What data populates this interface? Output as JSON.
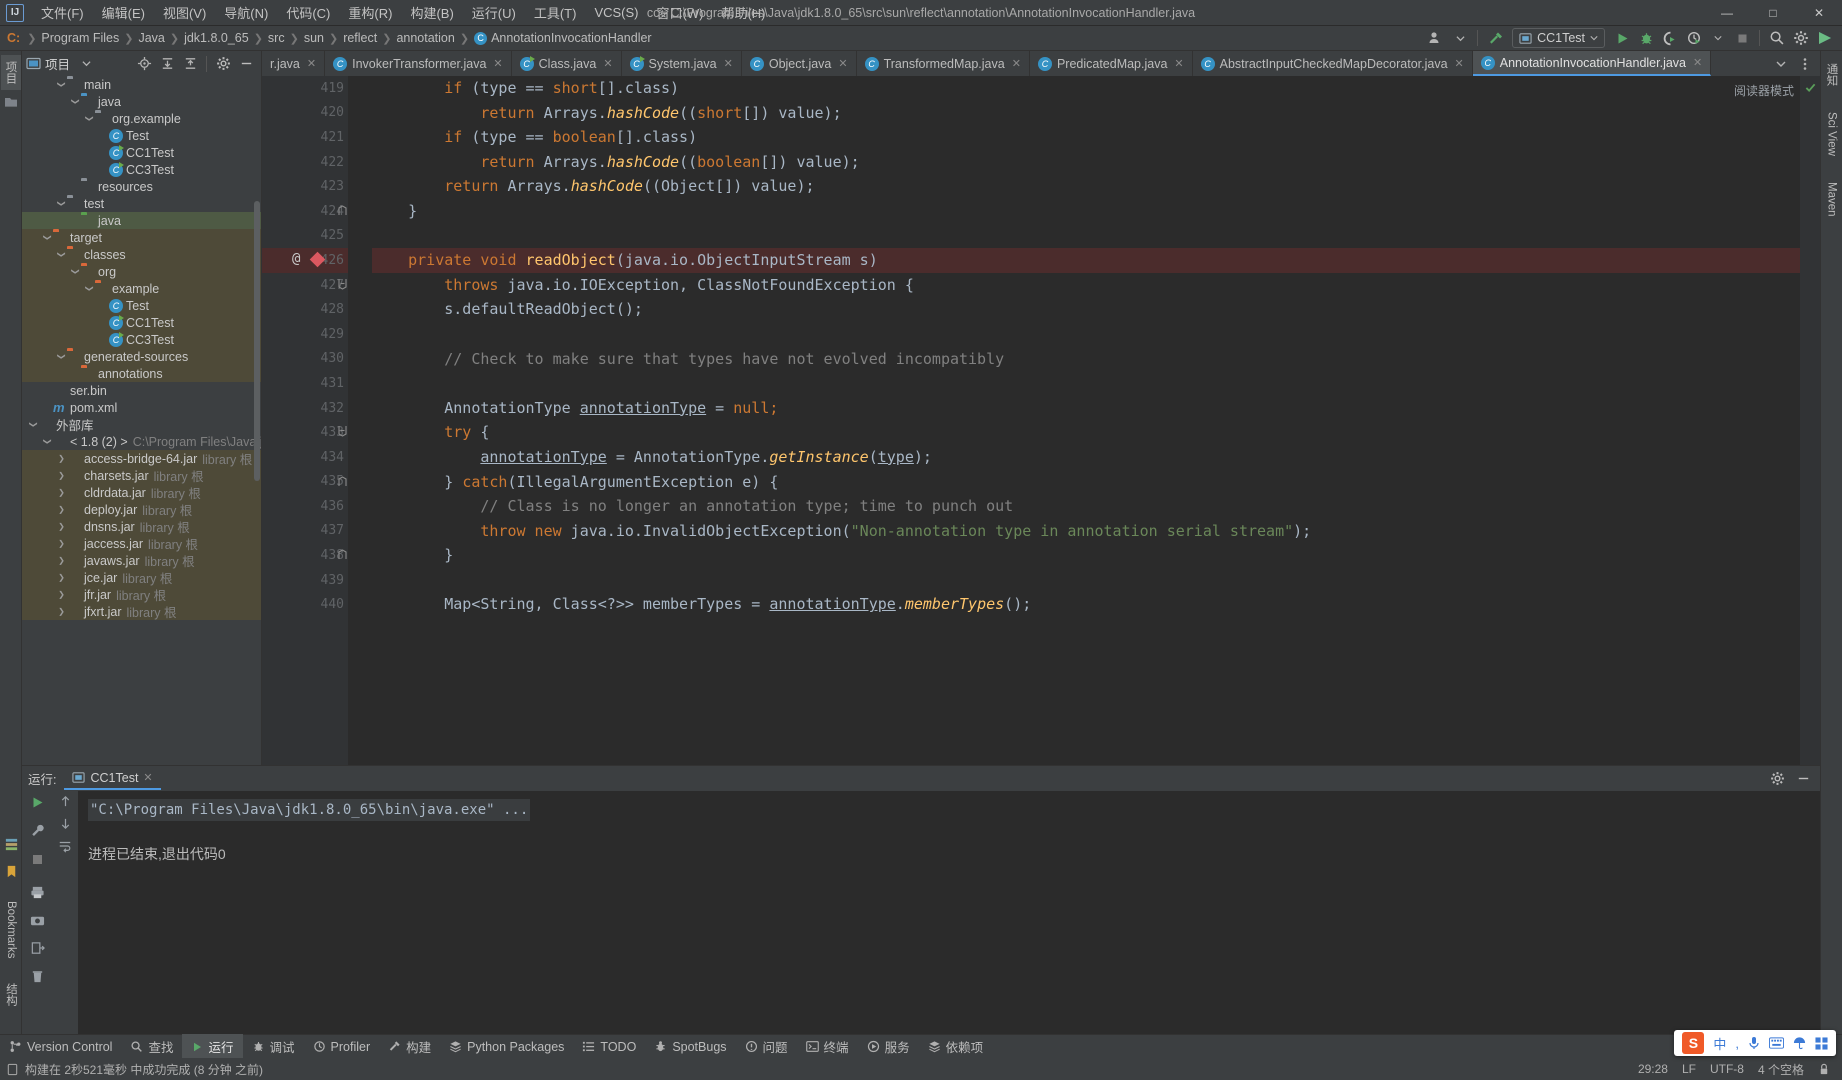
{
  "window": {
    "title": "cc - C:\\Program Files\\Java\\jdk1.8.0_65\\src\\sun\\reflect\\annotation\\AnnotationInvocationHandler.java",
    "logo": "IJ",
    "minimize": "—",
    "maximize": "□",
    "close": "✕"
  },
  "menubar": [
    {
      "label": "文件(F)"
    },
    {
      "label": "编辑(E)"
    },
    {
      "label": "视图(V)"
    },
    {
      "label": "导航(N)"
    },
    {
      "label": "代码(C)"
    },
    {
      "label": "重构(R)"
    },
    {
      "label": "构建(B)"
    },
    {
      "label": "运行(U)"
    },
    {
      "label": "工具(T)"
    },
    {
      "label": "VCS(S)"
    },
    {
      "label": "窗口(W)"
    },
    {
      "label": "帮助(H)"
    }
  ],
  "breadcrumbs": [
    {
      "label": "C:",
      "icon": "drive"
    },
    {
      "label": "Program Files",
      "icon": "folder"
    },
    {
      "label": "Java",
      "icon": "folder"
    },
    {
      "label": "jdk1.8.0_65",
      "icon": "folder"
    },
    {
      "label": "src",
      "icon": "folder"
    },
    {
      "label": "sun",
      "icon": "folder"
    },
    {
      "label": "reflect",
      "icon": "folder"
    },
    {
      "label": "annotation",
      "icon": "folder"
    },
    {
      "label": "AnnotationInvocationHandler",
      "icon": "class"
    }
  ],
  "toolbar": {
    "run_config": "CC1Test",
    "buttons": [
      {
        "name": "user-icon",
        "title": "用户"
      },
      {
        "name": "build-hammer-icon",
        "title": "构建"
      },
      {
        "name": "run-icon",
        "title": "运行"
      },
      {
        "name": "debug-icon",
        "title": "调试"
      },
      {
        "name": "run-with-coverage-icon",
        "title": "运行并计算覆盖率"
      },
      {
        "name": "profiler-icon",
        "title": "Profiler"
      },
      {
        "name": "stop-icon",
        "title": "停止"
      },
      {
        "name": "search-icon",
        "title": "搜索"
      },
      {
        "name": "settings-gear-icon",
        "title": "设置"
      },
      {
        "name": "app-badge-icon",
        "title": "IDE"
      }
    ]
  },
  "project_panel": {
    "title": "项目",
    "header_buttons": [
      "locate-icon",
      "expand-all-icon",
      "collapse-all-icon",
      "settings-gear-icon",
      "hide-icon"
    ],
    "tree": [
      {
        "label": "main",
        "indent": 2,
        "arrow": "v",
        "icon": "folder-grey",
        "state": "normal"
      },
      {
        "label": "java",
        "indent": 3,
        "arrow": "v",
        "icon": "folder-blue",
        "state": "normal"
      },
      {
        "label": "org.example",
        "indent": 4,
        "arrow": "v",
        "icon": "folder-pkg",
        "state": "normal"
      },
      {
        "label": "Test",
        "indent": 5,
        "arrow": "",
        "icon": "class",
        "state": "normal"
      },
      {
        "label": "CC1Test",
        "indent": 5,
        "arrow": "",
        "icon": "class-run",
        "state": "normal"
      },
      {
        "label": "CC3Test",
        "indent": 5,
        "arrow": "",
        "icon": "class-run",
        "state": "normal"
      },
      {
        "label": "resources",
        "indent": 3,
        "arrow": "",
        "icon": "folder-res",
        "state": "normal"
      },
      {
        "label": "test",
        "indent": 2,
        "arrow": "v",
        "icon": "folder-grey",
        "state": "normal"
      },
      {
        "label": "java",
        "indent": 3,
        "arrow": "",
        "icon": "folder-green",
        "state": "selected-green"
      },
      {
        "label": "target",
        "indent": 1,
        "arrow": "v",
        "icon": "folder-orange",
        "state": "context"
      },
      {
        "label": "classes",
        "indent": 2,
        "arrow": "v",
        "icon": "folder-orange",
        "state": "context"
      },
      {
        "label": "org",
        "indent": 3,
        "arrow": "v",
        "icon": "folder-orange",
        "state": "context"
      },
      {
        "label": "example",
        "indent": 4,
        "arrow": "v",
        "icon": "folder-orange",
        "state": "context"
      },
      {
        "label": "Test",
        "indent": 5,
        "arrow": "",
        "icon": "class",
        "state": "context"
      },
      {
        "label": "CC1Test",
        "indent": 5,
        "arrow": "",
        "icon": "class-run",
        "state": "context"
      },
      {
        "label": "CC3Test",
        "indent": 5,
        "arrow": "",
        "icon": "class-run",
        "state": "context"
      },
      {
        "label": "generated-sources",
        "indent": 2,
        "arrow": "v",
        "icon": "folder-orange",
        "state": "context"
      },
      {
        "label": "annotations",
        "indent": 3,
        "arrow": "",
        "icon": "folder-orange",
        "state": "context"
      },
      {
        "label": "ser.bin",
        "indent": 1,
        "arrow": "",
        "icon": "bin",
        "state": "normal"
      },
      {
        "label": "pom.xml",
        "indent": 1,
        "arrow": "",
        "icon": "maven",
        "state": "normal"
      },
      {
        "label": "外部库",
        "indent": 0,
        "arrow": "v",
        "icon": "library",
        "state": "normal"
      },
      {
        "label": "< 1.8 (2) >",
        "indent": 1,
        "arrow": "v",
        "icon": "sdk",
        "state": "normal",
        "sub": "C:\\Program Files\\Java\\jdk"
      },
      {
        "label": "access-bridge-64.jar",
        "indent": 2,
        "arrow": ">",
        "icon": "jar",
        "state": "context",
        "sub": "library 根"
      },
      {
        "label": "charsets.jar",
        "indent": 2,
        "arrow": ">",
        "icon": "jar",
        "state": "context",
        "sub": "library 根"
      },
      {
        "label": "cldrdata.jar",
        "indent": 2,
        "arrow": ">",
        "icon": "jar",
        "state": "context",
        "sub": "library 根"
      },
      {
        "label": "deploy.jar",
        "indent": 2,
        "arrow": ">",
        "icon": "jar",
        "state": "context",
        "sub": "library 根"
      },
      {
        "label": "dnsns.jar",
        "indent": 2,
        "arrow": ">",
        "icon": "jar",
        "state": "context",
        "sub": "library 根"
      },
      {
        "label": "jaccess.jar",
        "indent": 2,
        "arrow": ">",
        "icon": "jar",
        "state": "context",
        "sub": "library 根"
      },
      {
        "label": "javaws.jar",
        "indent": 2,
        "arrow": ">",
        "icon": "jar",
        "state": "context",
        "sub": "library 根"
      },
      {
        "label": "jce.jar",
        "indent": 2,
        "arrow": ">",
        "icon": "jar",
        "state": "context",
        "sub": "library 根"
      },
      {
        "label": "jfr.jar",
        "indent": 2,
        "arrow": ">",
        "icon": "jar",
        "state": "context",
        "sub": "library 根"
      },
      {
        "label": "jfxrt.jar",
        "indent": 2,
        "arrow": ">",
        "icon": "jar",
        "state": "context",
        "sub": "library 根"
      }
    ]
  },
  "left_strip": {
    "tabs": [
      "项目",
      "收藏"
    ],
    "bottom_tabs": [
      "Bookmarks",
      "结构"
    ]
  },
  "right_strip": {
    "tabs": [
      "通知",
      "Sci View",
      "Maven"
    ]
  },
  "editor": {
    "tabs": [
      {
        "label": "r.java",
        "icon": "class",
        "active": false,
        "clipped": true
      },
      {
        "label": "InvokerTransformer.java",
        "icon": "class",
        "active": false
      },
      {
        "label": "Class.java",
        "icon": "class-run",
        "active": false
      },
      {
        "label": "System.java",
        "icon": "class-run",
        "active": false
      },
      {
        "label": "Object.java",
        "icon": "class",
        "active": false
      },
      {
        "label": "TransformedMap.java",
        "icon": "class",
        "active": false
      },
      {
        "label": "PredicatedMap.java",
        "icon": "class",
        "active": false
      },
      {
        "label": "AbstractInputCheckedMapDecorator.java",
        "icon": "class-abstract",
        "active": false
      },
      {
        "label": "AnnotationInvocationHandler.java",
        "icon": "class",
        "active": true
      }
    ],
    "reader_mode": "阅读器模式",
    "first_line": 419,
    "lines": [
      {
        "n": 419,
        "fold": "",
        "marker": "",
        "highlight": false,
        "tokens": [
          {
            "t": "        ",
            "c": ""
          },
          {
            "t": "if",
            "c": "kw"
          },
          {
            "t": " (type == ",
            "c": "typ"
          },
          {
            "t": "short",
            "c": "kw"
          },
          {
            "t": "[].class)",
            "c": "typ"
          }
        ]
      },
      {
        "n": 420,
        "fold": "",
        "marker": "",
        "highlight": false,
        "tokens": [
          {
            "t": "            ",
            "c": ""
          },
          {
            "t": "return",
            "c": "kw"
          },
          {
            "t": " Arrays.",
            "c": "typ"
          },
          {
            "t": "hashCode",
            "c": "fni"
          },
          {
            "t": "((",
            "c": "typ"
          },
          {
            "t": "short",
            "c": "kw"
          },
          {
            "t": "[]) value);",
            "c": "typ"
          }
        ]
      },
      {
        "n": 421,
        "fold": "",
        "marker": "",
        "highlight": false,
        "tokens": [
          {
            "t": "        ",
            "c": ""
          },
          {
            "t": "if",
            "c": "kw"
          },
          {
            "t": " (type == ",
            "c": "typ"
          },
          {
            "t": "boolean",
            "c": "kw"
          },
          {
            "t": "[].class)",
            "c": "typ"
          }
        ]
      },
      {
        "n": 422,
        "fold": "",
        "marker": "",
        "highlight": false,
        "tokens": [
          {
            "t": "            ",
            "c": ""
          },
          {
            "t": "return",
            "c": "kw"
          },
          {
            "t": " Arrays.",
            "c": "typ"
          },
          {
            "t": "hashCode",
            "c": "fni"
          },
          {
            "t": "((",
            "c": "typ"
          },
          {
            "t": "boolean",
            "c": "kw"
          },
          {
            "t": "[]) value);",
            "c": "typ"
          }
        ]
      },
      {
        "n": 423,
        "fold": "",
        "marker": "",
        "highlight": false,
        "tokens": [
          {
            "t": "        ",
            "c": ""
          },
          {
            "t": "return",
            "c": "kw"
          },
          {
            "t": " Arrays.",
            "c": "typ"
          },
          {
            "t": "hashCode",
            "c": "fni"
          },
          {
            "t": "((Object[]) value);",
            "c": "typ"
          }
        ]
      },
      {
        "n": 424,
        "fold": "end",
        "marker": "",
        "highlight": false,
        "tokens": [
          {
            "t": "    }",
            "c": "typ"
          }
        ]
      },
      {
        "n": 425,
        "fold": "",
        "marker": "",
        "highlight": false,
        "tokens": []
      },
      {
        "n": 426,
        "fold": "",
        "marker": "breakpoint",
        "highlight": true,
        "tokens": [
          {
            "t": "    ",
            "c": ""
          },
          {
            "t": "private void ",
            "c": "kw"
          },
          {
            "t": "readObject",
            "c": "fn"
          },
          {
            "t": "(java.io.ObjectInputStream s)",
            "c": "typ"
          }
        ]
      },
      {
        "n": 427,
        "fold": "start",
        "marker": "",
        "highlight": false,
        "tokens": [
          {
            "t": "        ",
            "c": ""
          },
          {
            "t": "throws",
            "c": "kw"
          },
          {
            "t": " java.io.IOException, ClassNotFoundException {",
            "c": "typ"
          }
        ]
      },
      {
        "n": 428,
        "fold": "",
        "marker": "",
        "highlight": false,
        "tokens": [
          {
            "t": "        s.defaultReadObject();",
            "c": "typ"
          }
        ]
      },
      {
        "n": 429,
        "fold": "",
        "marker": "",
        "highlight": false,
        "tokens": []
      },
      {
        "n": 430,
        "fold": "",
        "marker": "",
        "highlight": false,
        "tokens": [
          {
            "t": "        // Check to make sure that types have not evolved incompatibly",
            "c": "cmt"
          }
        ]
      },
      {
        "n": 431,
        "fold": "",
        "marker": "",
        "highlight": false,
        "tokens": []
      },
      {
        "n": 432,
        "fold": "",
        "marker": "",
        "highlight": false,
        "tokens": [
          {
            "t": "        AnnotationType ",
            "c": "typ"
          },
          {
            "t": "annotationType",
            "c": "loc"
          },
          {
            "t": " = ",
            "c": "typ"
          },
          {
            "t": "null;",
            "c": "kw"
          }
        ]
      },
      {
        "n": 433,
        "fold": "start",
        "marker": "",
        "highlight": false,
        "tokens": [
          {
            "t": "        ",
            "c": ""
          },
          {
            "t": "try",
            "c": "kw"
          },
          {
            "t": " {",
            "c": "typ"
          }
        ]
      },
      {
        "n": 434,
        "fold": "",
        "marker": "",
        "highlight": false,
        "tokens": [
          {
            "t": "            ",
            "c": ""
          },
          {
            "t": "annotationType",
            "c": "loc"
          },
          {
            "t": " = AnnotationType.",
            "c": "typ"
          },
          {
            "t": "getInstance",
            "c": "fni"
          },
          {
            "t": "(",
            "c": "typ"
          },
          {
            "t": "type",
            "c": "loc"
          },
          {
            "t": ");",
            "c": "typ"
          }
        ]
      },
      {
        "n": 435,
        "fold": "end",
        "marker": "",
        "highlight": false,
        "tokens": [
          {
            "t": "        } ",
            "c": "typ"
          },
          {
            "t": "catch",
            "c": "kw"
          },
          {
            "t": "(IllegalArgumentException e) {",
            "c": "typ"
          }
        ]
      },
      {
        "n": 436,
        "fold": "",
        "marker": "",
        "highlight": false,
        "tokens": [
          {
            "t": "            // Class is no longer an annotation type; time to punch out",
            "c": "cmt"
          }
        ]
      },
      {
        "n": 437,
        "fold": "",
        "marker": "",
        "highlight": false,
        "tokens": [
          {
            "t": "            ",
            "c": ""
          },
          {
            "t": "throw new",
            "c": "kw"
          },
          {
            "t": " java.io.InvalidObjectException(",
            "c": "typ"
          },
          {
            "t": "\"Non-annotation type in annotation serial stream\"",
            "c": "str"
          },
          {
            "t": ");",
            "c": "typ"
          }
        ]
      },
      {
        "n": 438,
        "fold": "end",
        "marker": "",
        "highlight": false,
        "tokens": [
          {
            "t": "        }",
            "c": "typ"
          }
        ]
      },
      {
        "n": 439,
        "fold": "",
        "marker": "",
        "highlight": false,
        "tokens": []
      },
      {
        "n": 440,
        "fold": "",
        "marker": "",
        "highlight": false,
        "tokens": [
          {
            "t": "        Map<String, Class<?>> memberTypes = ",
            "c": "typ"
          },
          {
            "t": "annotationType",
            "c": "loc"
          },
          {
            "t": ".",
            "c": "typ"
          },
          {
            "t": "memberTypes",
            "c": "fni"
          },
          {
            "t": "();",
            "c": "typ"
          }
        ]
      }
    ]
  },
  "run_panel": {
    "label": "运行:",
    "tab": "CC1Test",
    "command": "\"C:\\Program Files\\Java\\jdk1.8.0_65\\bin\\java.exe\" ...",
    "output": "进程已结束,退出代码0",
    "tool_buttons": [
      "run-icon",
      "wrench-icon",
      "stop-icon",
      "up-arrow-icon",
      "down-arrow-icon",
      "wrap-text-icon",
      "print-icon",
      "camera-icon",
      "trash-icon",
      "export-icon"
    ],
    "header_buttons": [
      "settings-gear-icon",
      "hide-icon"
    ]
  },
  "tool_window_bar": [
    {
      "label": "Version Control",
      "icon": "branch-icon",
      "active": false
    },
    {
      "label": "查找",
      "icon": "search-icon",
      "active": false
    },
    {
      "label": "运行",
      "icon": "run-icon",
      "active": true
    },
    {
      "label": "调试",
      "icon": "debug-icon",
      "active": false
    },
    {
      "label": "Profiler",
      "icon": "profiler-icon",
      "active": false
    },
    {
      "label": "构建",
      "icon": "build-hammer-icon",
      "active": false
    },
    {
      "label": "Python Packages",
      "icon": "packages-icon",
      "active": false
    },
    {
      "label": "TODO",
      "icon": "todo-icon",
      "active": false
    },
    {
      "label": "SpotBugs",
      "icon": "bug-icon",
      "active": false
    },
    {
      "label": "问题",
      "icon": "problems-icon",
      "active": false
    },
    {
      "label": "终端",
      "icon": "terminal-icon",
      "active": false
    },
    {
      "label": "服务",
      "icon": "services-icon",
      "active": false
    },
    {
      "label": "依赖项",
      "icon": "dependencies-icon",
      "active": false
    }
  ],
  "status_bar": {
    "message": "构建在 2秒521毫秒 中成功完成 (8 分钟 之前)",
    "caret": "29:28",
    "line_separator": "LF",
    "encoding": "UTF-8",
    "indent": "4 个空格",
    "lock_icon": "lock-icon"
  },
  "ime_bar": {
    "logo": "S",
    "mode": "中",
    "items": [
      "punctuation-icon",
      "mic-icon",
      "keyboard-icon",
      "umbrella-icon",
      "toolbox-icon"
    ]
  },
  "colors": {
    "accent_blue": "#4e9ae2",
    "editor_bg": "#2b2b2b",
    "panel_bg": "#3c3f41",
    "gutter_bg": "#313335",
    "keyword": "#cc7832",
    "string": "#6a8759",
    "comment": "#808080",
    "function": "#ffc66d",
    "breakpoint_red": "#db5860",
    "highlight_row": "#4b2c2c"
  }
}
